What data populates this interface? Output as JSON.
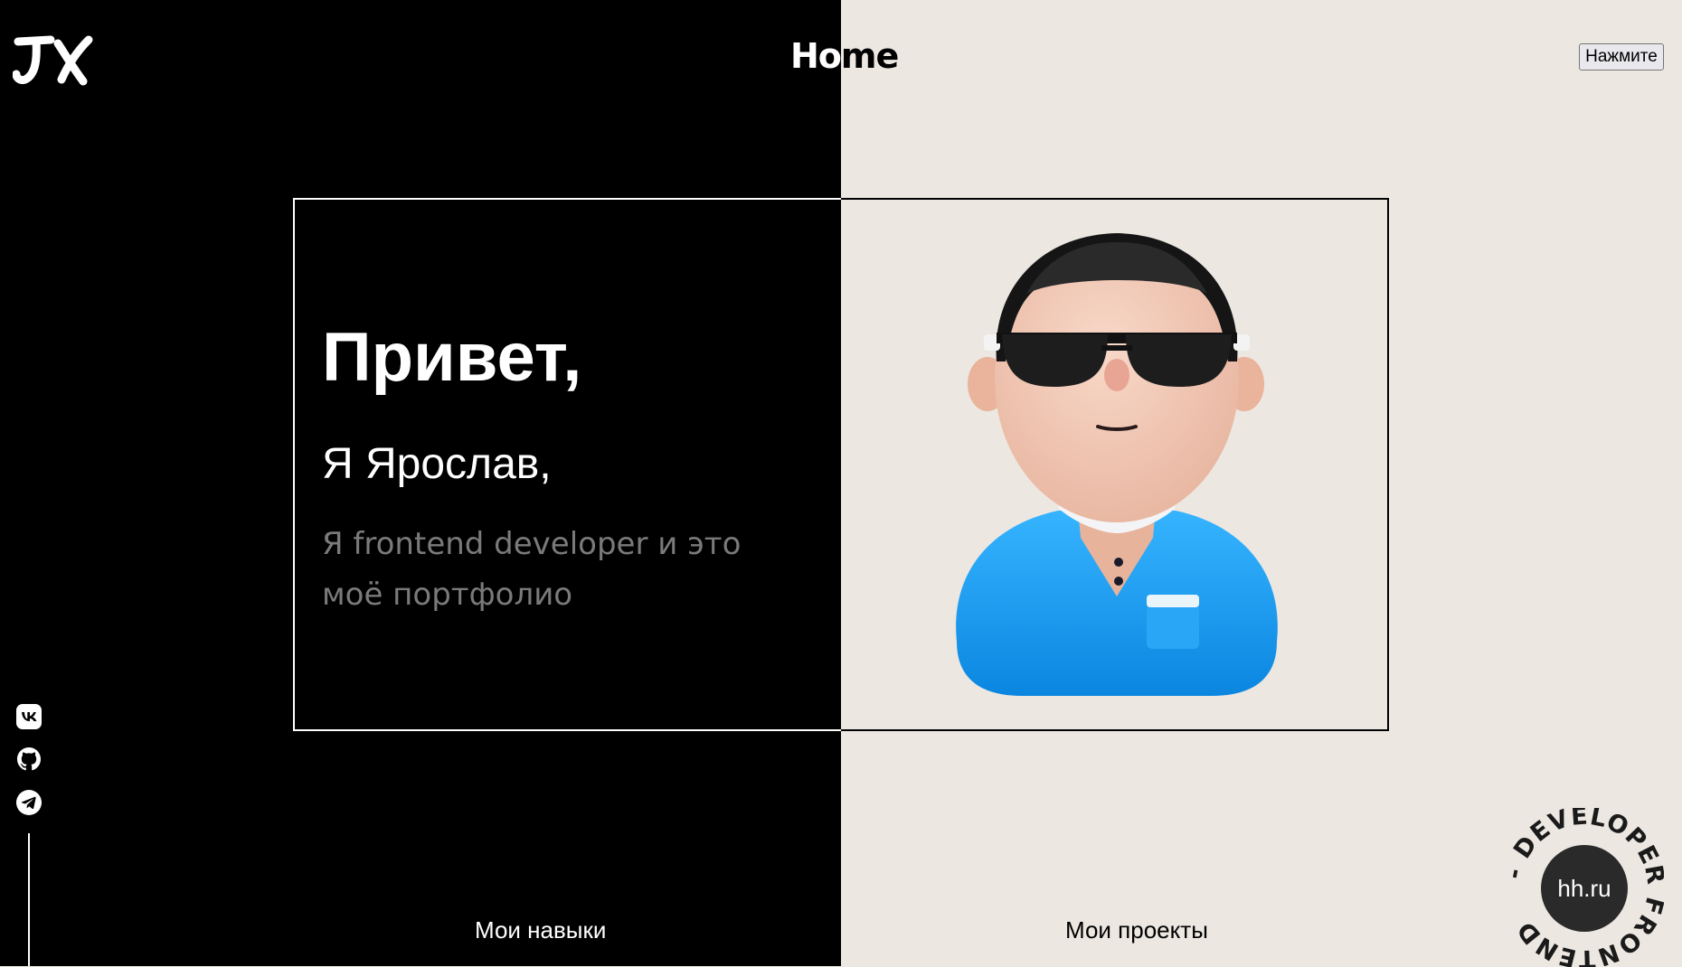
{
  "header": {
    "logo_text": "JX",
    "title": "Home",
    "press_button_label": "Нажмите"
  },
  "hero": {
    "greeting": "Привет,",
    "name_line": "Я Ярослав,",
    "subtitle": "Я frontend developer и это моё портфолио"
  },
  "socials": [
    {
      "name": "vk-icon"
    },
    {
      "name": "github-icon"
    },
    {
      "name": "telegram-icon"
    }
  ],
  "footer": {
    "skills_label": "Мои навыки",
    "projects_label": "Мои проекты"
  },
  "badge": {
    "center_label": "hh.ru",
    "ring_text": "- DEVELOPER FRONTEND"
  },
  "colors": {
    "dark_bg": "#000000",
    "light_bg": "#ece7e1",
    "subtitle_gray": "#7a7a7a",
    "shirt_blue": "#1e9ff2"
  }
}
